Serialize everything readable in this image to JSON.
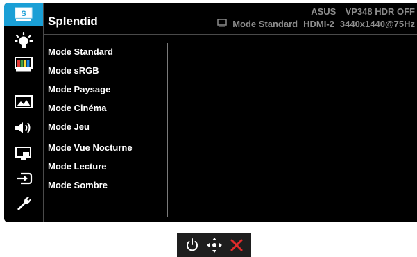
{
  "header": {
    "title": "Splendid",
    "brand": "ASUS",
    "model": "VP348 HDR OFF",
    "current_mode": "Mode Standard",
    "input": "HDMI-2",
    "resolution": "3440x1440@75Hz"
  },
  "sidebar": {
    "items": [
      {
        "icon": "splendid-icon",
        "active": true
      },
      {
        "icon": "blue-light-filter-icon",
        "active": false
      },
      {
        "icon": "color-icon",
        "active": false
      },
      {
        "icon": "image-icon",
        "active": false
      },
      {
        "icon": "sound-icon",
        "active": false
      },
      {
        "icon": "pip-pbp-icon",
        "active": false
      },
      {
        "icon": "input-select-icon",
        "active": false
      },
      {
        "icon": "system-setup-icon",
        "active": false
      }
    ]
  },
  "modes": [
    "Mode Standard",
    "Mode sRGB",
    "Mode Paysage",
    "Mode Cinéma",
    "Mode Jeu",
    "Mode Vue Nocturne",
    "Mode Lecture",
    "Mode Sombre"
  ],
  "colors": {
    "accent": "#1a9fd6",
    "close": "#e22b2b",
    "header_text": "#8c8c8c"
  },
  "controls": {
    "icons": [
      "power-icon",
      "five-way-joystick-icon",
      "close-icon"
    ]
  }
}
